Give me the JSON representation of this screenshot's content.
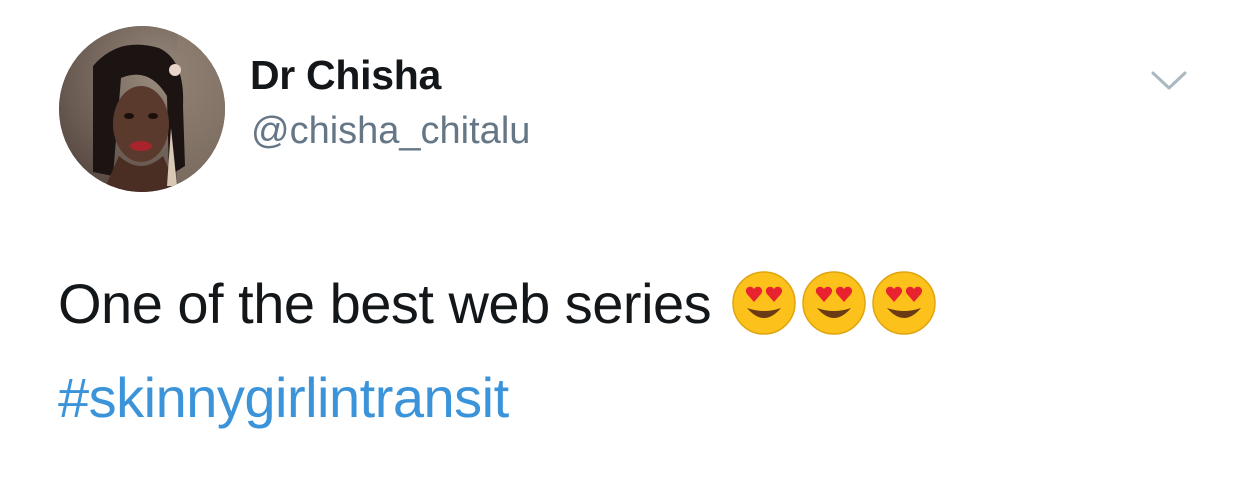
{
  "author": {
    "display_name": "Dr Chisha",
    "handle": "@chisha_chitalu",
    "avatar_icon": "profile-photo"
  },
  "tweet": {
    "text": "One of the best web series",
    "emojis": [
      "heart-eyes-emoji",
      "heart-eyes-emoji",
      "heart-eyes-emoji"
    ],
    "hashtag": "#skinnygirlintransit"
  },
  "menu": {
    "icon": "chevron-down-icon"
  },
  "colors": {
    "name": "#14171a",
    "handle": "#657786",
    "text": "#14171a",
    "hashtag": "#3b94d9",
    "chevron": "#aab8c2"
  }
}
